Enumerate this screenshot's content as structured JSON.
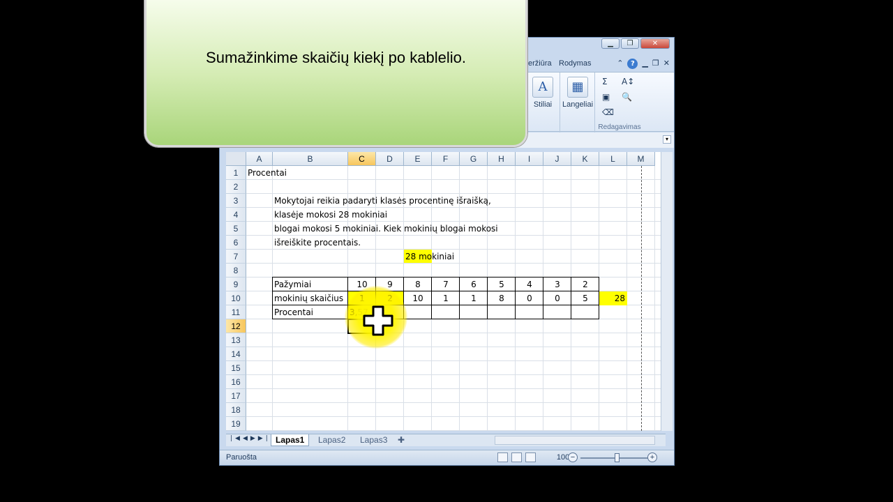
{
  "callout": {
    "text": "Sumažinkime skaičių kiekį po kablelio."
  },
  "window": {
    "controls": [
      "▁",
      "❐",
      "✕"
    ],
    "tabs": [
      {
        "label": "eržiūra"
      },
      {
        "label": "Rodymas"
      }
    ]
  },
  "ribbon": {
    "styles_label": "Stiliai",
    "cells_label": "Langeliai",
    "editing_group": "Redagavimas",
    "sum_glyph": "Σ",
    "sort_glyph": "A↕",
    "find_glyph": "🔍",
    "clear_glyph": "⌫"
  },
  "sheet": {
    "columns": [
      "A",
      "B",
      "C",
      "D",
      "E",
      "F",
      "G",
      "H",
      "I",
      "J",
      "K",
      "L",
      "M"
    ],
    "rows": [
      "1",
      "2",
      "3",
      "4",
      "5",
      "6",
      "7",
      "8",
      "9",
      "10",
      "11",
      "12",
      "13",
      "14",
      "15",
      "16",
      "17",
      "18",
      "19"
    ],
    "active_cell": "C12",
    "cells": {
      "A1": "Procentai",
      "B3": "Mokytojai reikia padaryti klasės procentinę išraišką,",
      "B4": "klasėje mokosi 28 mokiniai",
      "B5": "blogai mokosi 5 mokiniai. Kiek mokinių blogai mokosi",
      "B6": "išreiškite procentais.",
      "E7": "28 mokiniai",
      "B9": "Pažymiai",
      "B10": "mokinių skaičius",
      "B11": "Procentai",
      "C11": "3,57",
      "L10": "28"
    },
    "grades": [
      "10",
      "9",
      "8",
      "7",
      "6",
      "5",
      "4",
      "3",
      "2"
    ],
    "counts": [
      "1",
      "2",
      "10",
      "1",
      "1",
      "8",
      "0",
      "0",
      "5"
    ],
    "highlight_color": "#ffff00"
  },
  "sheet_tabs": [
    {
      "label": "Lapas1",
      "active": true
    },
    {
      "label": "Lapas2",
      "active": false
    },
    {
      "label": "Lapas3",
      "active": false
    }
  ],
  "status": {
    "text": "Paruošta",
    "zoom": "100%"
  }
}
